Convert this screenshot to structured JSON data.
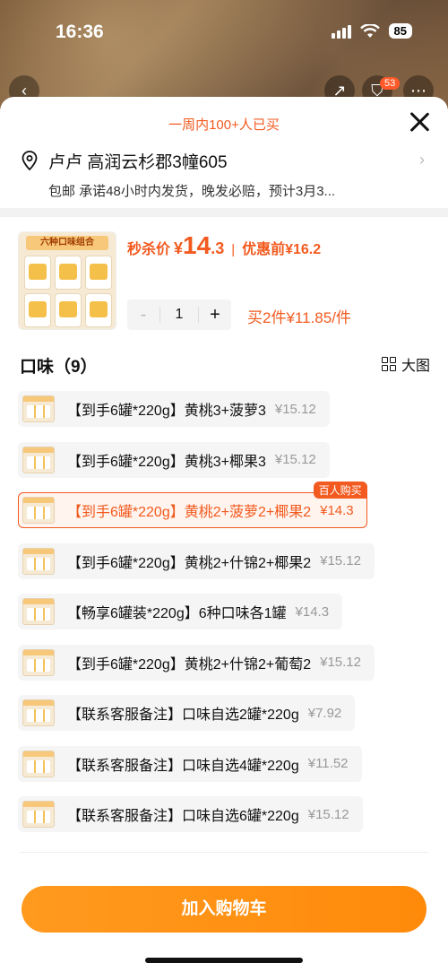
{
  "status_bar": {
    "time": "16:36",
    "battery": "85"
  },
  "background": {
    "cart_badge": "53"
  },
  "sheet": {
    "purchase_count": "一周内100+人已买",
    "address": "卢卢 高润云杉郡3幢605",
    "shipping": "包邮 承诺48小时内发货，晚发必赔，预计3月3...",
    "product": {
      "thumb_banner": "六种口味组合",
      "price_label": "秒杀价",
      "currency": "¥",
      "price_int": "14",
      "price_dec": ".3",
      "separator": "|",
      "original_label": "优惠前¥16.2",
      "quantity": "1",
      "minus": "-",
      "plus": "+",
      "bulk_price": "买2件¥11.85/件"
    },
    "flavor": {
      "title": "口味（9）",
      "view_toggle": "大图"
    },
    "options": [
      {
        "name": "【到手6罐*220g】黄桃3+菠萝3",
        "price": "¥15.12",
        "selected": false
      },
      {
        "name": "【到手6罐*220g】黄桃3+椰果3",
        "price": "¥15.12",
        "selected": false
      },
      {
        "name": "【到手6罐*220g】黄桃2+菠萝2+椰果2",
        "price": "¥14.3",
        "selected": true,
        "tag": "百人购买"
      },
      {
        "name": "【到手6罐*220g】黄桃2+什锦2+椰果2",
        "price": "¥15.12",
        "selected": false
      },
      {
        "name": "【畅享6罐装*220g】6种口味各1罐",
        "price": "¥14.3",
        "selected": false
      },
      {
        "name": "【到手6罐*220g】黄桃2+什锦2+葡萄2",
        "price": "¥15.12",
        "selected": false
      },
      {
        "name": "【联系客服备注】口味自选2罐*220g",
        "price": "¥7.92",
        "selected": false
      },
      {
        "name": "【联系客服备注】口味自选4罐*220g",
        "price": "¥11.52",
        "selected": false
      },
      {
        "name": "【联系客服备注】口味自选6罐*220g",
        "price": "¥15.12",
        "selected": false
      }
    ],
    "add_to_cart": "加入购物车"
  },
  "colors": {
    "accent": "#f25a1f",
    "cta": "#ff8f14"
  }
}
